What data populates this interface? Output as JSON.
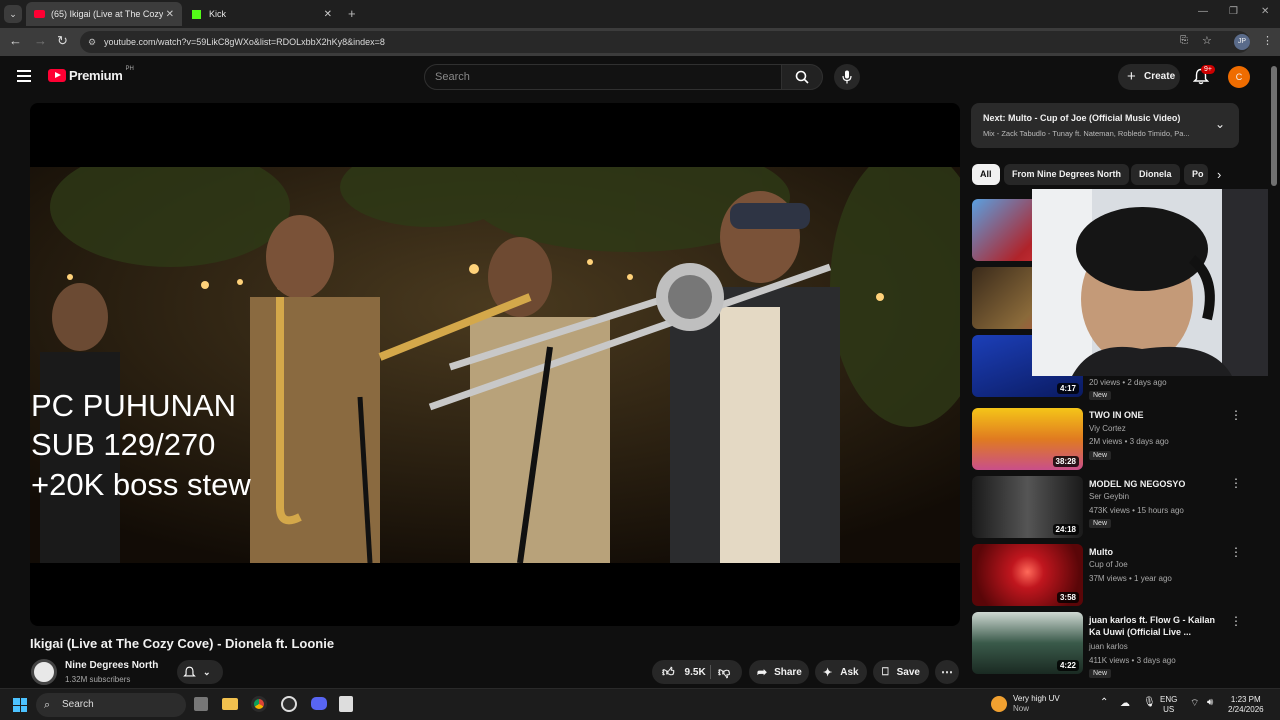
{
  "browser": {
    "tabs": [
      {
        "label": "(65) Ikigai (Live at The Cozy Cov"
      },
      {
        "label": "Kick"
      }
    ],
    "url": "youtube.com/watch?v=59LikC8gWXo&list=RDOLxbbX2hKy8&index=8",
    "profile": "JP"
  },
  "header": {
    "logo": "Premium",
    "region": "PH",
    "search_placeholder": "Search",
    "create_label": "Create",
    "notifications": "9+",
    "avatar_letter": "C"
  },
  "player": {
    "overlay_lines": [
      "PC PUHUNAN",
      "SUB 129/270",
      "+20K boss stew"
    ]
  },
  "video": {
    "title": "Ikigai (Live at The Cozy Cove) - Dionela ft. Loonie",
    "channel": "Nine Degrees North",
    "subscribers": "1.32M subscribers",
    "likes": "9.5K",
    "share_label": "Share",
    "ask_label": "Ask",
    "save_label": "Save"
  },
  "upnext": {
    "title": "Next: Multo - Cup of Joe (Official Music Video)",
    "subtitle": "Mix - Zack Tabudlo - Tunay ft. Nateman, Robledo Timido, Pa..."
  },
  "chips": [
    "All",
    "From Nine Degrees North",
    "Dionela",
    "Po"
  ],
  "recommendations": [
    {
      "title": "",
      "channel": "",
      "meta": "",
      "duration": "",
      "new": "",
      "thumb_color": "#b0232a"
    },
    {
      "title": "",
      "channel": "",
      "meta": "",
      "duration": "",
      "new": "",
      "thumb_color": "#6b4a2a"
    },
    {
      "title": "",
      "channel": "",
      "meta": "20 views • 2 days ago",
      "duration": "4:17",
      "new": "New",
      "thumb_color": "#1c3fb8"
    },
    {
      "title": "TWO IN ONE",
      "channel": "Viy Cortez",
      "meta": "2M views • 3 days ago",
      "duration": "38:28",
      "new": "New",
      "thumb_color": "#e0a020"
    },
    {
      "title": "MODEL NG NEGOSYO",
      "channel": "Ser Geybin",
      "meta": "473K views • 15 hours ago",
      "duration": "24:18",
      "new": "New",
      "thumb_color": "#3a3a3a"
    },
    {
      "title": "Multo",
      "channel": "Cup of Joe",
      "meta": "37M views • 1 year ago",
      "duration": "3:58",
      "new": "",
      "thumb_color": "#8a0c10"
    },
    {
      "title": "juan karlos ft. Flow G - Kailan Ka Uuwi  (Official Live ...",
      "channel": "juan karlos",
      "meta": "411K views • 3 days ago",
      "duration": "4:22",
      "new": "New",
      "thumb_color": "#2d4a3a"
    }
  ],
  "taskbar": {
    "search": "Search",
    "weather_title": "Very high UV",
    "weather_sub": "Now",
    "lang1": "ENG",
    "lang2": "US",
    "time": "1:23 PM",
    "date": "2/24/2026"
  }
}
